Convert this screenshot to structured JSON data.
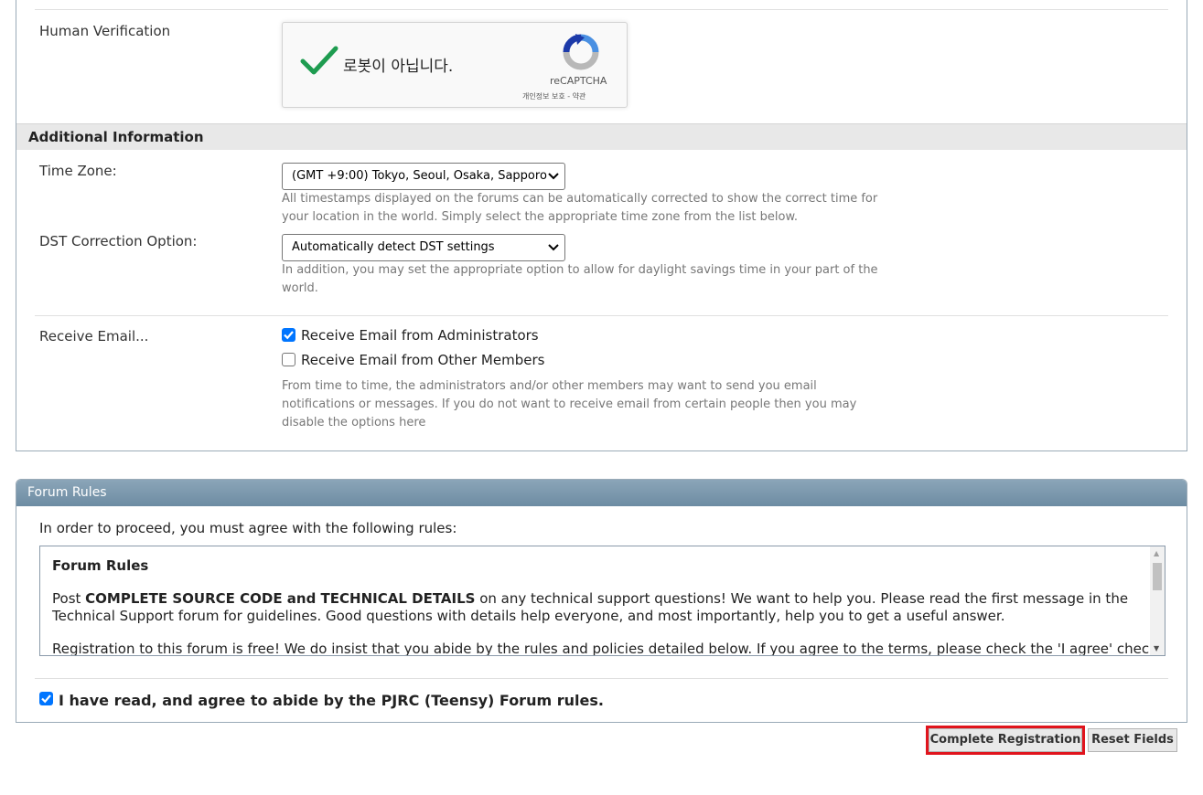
{
  "verification": {
    "label": "Human Verification",
    "captcha_text": "로봇이 아닙니다.",
    "captcha_brand": "reCAPTCHA",
    "captcha_links": "개인정보 보호 - 약관"
  },
  "additional": {
    "heading": "Additional Information",
    "timezone": {
      "label": "Time Zone:",
      "selected": "(GMT +9:00) Tokyo, Seoul, Osaka, Sapporo",
      "desc_line1": "All timestamps displayed on the forums can be automatically corrected to show the correct time for",
      "desc_line2": "your location in the world. Simply select the appropriate time zone from the list below."
    },
    "dst": {
      "label": "DST Correction Option:",
      "selected": "Automatically detect DST settings",
      "desc_line1": "In addition, you may set the appropriate option to allow for daylight savings time in your part of the",
      "desc_line2": "world."
    },
    "email": {
      "label": "Receive Email...",
      "opt_admin": "Receive Email from Administrators",
      "opt_admin_checked": true,
      "opt_members": "Receive Email from Other Members",
      "opt_members_checked": false,
      "desc_line1": "From time to time, the administrators and/or other members may want to send you email",
      "desc_line2": "notifications or messages. If you do not want to receive email from certain people then you may",
      "desc_line3": "disable the options here"
    }
  },
  "rules": {
    "header": "Forum Rules",
    "intro": "In order to proceed, you must agree with the following rules:",
    "content_title": "Forum Rules",
    "para1_bold": "COMPLETE SOURCE CODE and TECHNICAL DETAILS",
    "para1_pre": "Post ",
    "para1_rest": " on any technical support questions! We want to help you. Please read the first message in the Technical Support forum for guidelines. Good questions with details help everyone, and most importantly, help you to get a useful answer.",
    "para2": "Registration to this forum is free! We do insist that you abide by the rules and policies detailed below. If you agree to the terms, please check the 'I agree' checkbox",
    "agree_label": "I have read, and agree to abide by the PJRC (Teensy) Forum rules.",
    "agree_checked": true
  },
  "buttons": {
    "complete": "Complete Registration",
    "reset": "Reset Fields"
  },
  "colors": {
    "highlight": "#e0141d",
    "panel_header": "#7a97ac",
    "checkbox": "#0075ff",
    "captcha_check": "#1e9c50"
  }
}
